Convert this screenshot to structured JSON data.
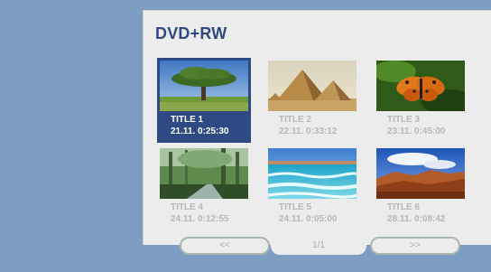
{
  "disc": {
    "title": "DVD+RW"
  },
  "titles": [
    {
      "name": "TITLE 1",
      "datetime": "21.11.  0:25:30",
      "thumb": "tree-thumbnail",
      "selected": true
    },
    {
      "name": "TITLE 2",
      "datetime": "22.11.  0:33:12",
      "thumb": "pyramids-thumbnail",
      "selected": false
    },
    {
      "name": "TITLE 3",
      "datetime": "23.11.  0:45:00",
      "thumb": "butterfly-thumbnail",
      "selected": false
    },
    {
      "name": "TITLE 4",
      "datetime": "24.11.  0:12:55",
      "thumb": "forest-thumbnail",
      "selected": false
    },
    {
      "name": "TITLE 5",
      "datetime": "24.11.  0:05:00",
      "thumb": "beach-thumbnail",
      "selected": false
    },
    {
      "name": "TITLE 6",
      "datetime": "28.11.  0:08:42",
      "thumb": "canyon-thumbnail",
      "selected": false
    }
  ],
  "nav": {
    "prev": "<<",
    "page": "1/1",
    "next": ">>"
  },
  "colors": {
    "accent": "#2f4a82",
    "background": "#7d9dc3",
    "panel": "#ececec",
    "inactive_text": "#b4b8bd"
  }
}
